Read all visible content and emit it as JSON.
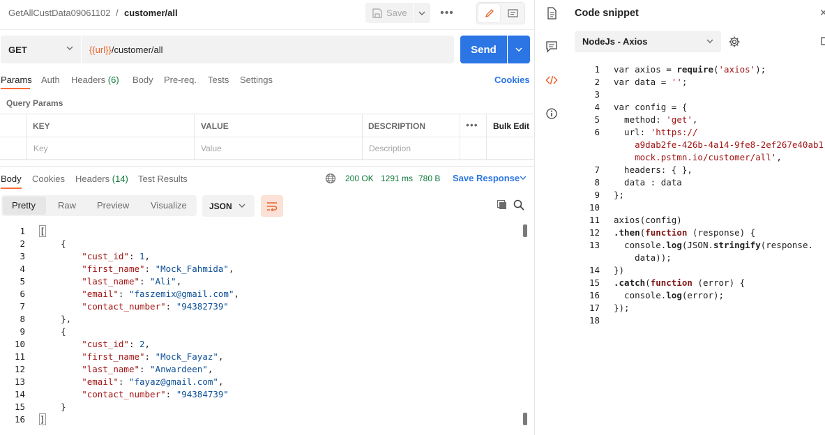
{
  "header": {
    "collection": "GetAllCustData09061102",
    "separator": "/",
    "request_name": "customer/all",
    "save_label": "Save"
  },
  "request": {
    "method": "GET",
    "url_var": "{{url}}",
    "url_path": "/customer/all",
    "send_label": "Send"
  },
  "request_tabs": {
    "params": "Params",
    "auth": "Auth",
    "headers": "Headers",
    "headers_count": "(6)",
    "body": "Body",
    "prereq": "Pre-req.",
    "tests": "Tests",
    "settings": "Settings",
    "cookies": "Cookies"
  },
  "query_params": {
    "title": "Query Params",
    "columns": {
      "key": "KEY",
      "value": "VALUE",
      "description": "DESCRIPTION",
      "bulk_edit": "Bulk Edit"
    },
    "placeholders": {
      "key": "Key",
      "value": "Value",
      "description": "Description"
    }
  },
  "response_tabs": {
    "body": "Body",
    "cookies": "Cookies",
    "headers": "Headers",
    "headers_count": "(14)",
    "test_results": "Test Results",
    "status": "200 OK",
    "time": "1291 ms",
    "size": "780 B",
    "save_response": "Save Response"
  },
  "response_view": {
    "pretty": "Pretty",
    "raw": "Raw",
    "preview": "Preview",
    "visualize": "Visualize",
    "format": "JSON"
  },
  "response_body": {
    "line_numbers": [
      "1",
      "2",
      "3",
      "4",
      "5",
      "6",
      "7",
      "8",
      "9",
      "10",
      "11",
      "12",
      "13",
      "14",
      "15",
      "16"
    ],
    "records": [
      {
        "cust_id": "1",
        "first_name": "\"Mock_Fahmida\"",
        "last_name": "\"Ali\"",
        "email": "\"faszemix@gmail.com\"",
        "contact_number": "\"94382739\""
      },
      {
        "cust_id": "2",
        "first_name": "\"Mock_Fayaz\"",
        "last_name": "\"Anwardeen\"",
        "email": "\"fayaz@gmail.com\"",
        "contact_number": "\"94384739\""
      }
    ],
    "keys": {
      "cust_id": "\"cust_id\"",
      "first_name": "\"first_name\"",
      "last_name": "\"last_name\"",
      "email": "\"email\"",
      "contact_number": "\"contact_number\""
    }
  },
  "snippet": {
    "title": "Code snippet",
    "language": "NodeJs - Axios",
    "line_numbers": [
      "1",
      "2",
      "3",
      "4",
      "5",
      "6",
      "",
      "",
      "7",
      "8",
      "9",
      "10",
      "11",
      "12",
      "13",
      "",
      "14",
      "15",
      "16",
      "17",
      "18"
    ],
    "url_line1": "'https://",
    "url_line2": "a9dab2fe-426b-4a14-9fe8-2ef267e40ab1.",
    "url_line3": "mock.pstmn.io/customer/all'",
    "require_arg": "'axios'",
    "empty_string": "''",
    "method_value": "'get'"
  }
}
